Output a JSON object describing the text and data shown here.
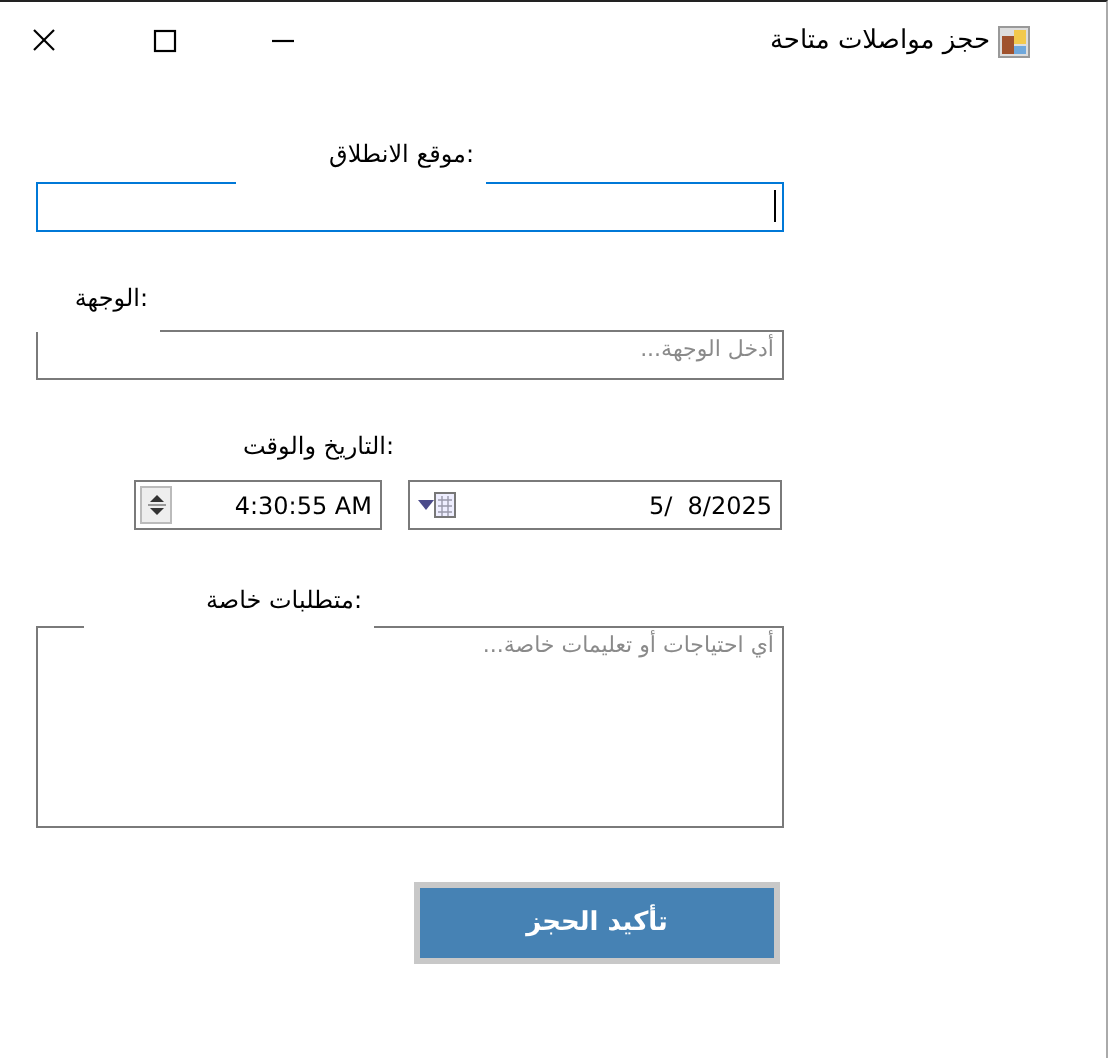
{
  "window": {
    "title": "حجز مواصلات متاحة"
  },
  "fields": [
    {
      "kind": "text",
      "label": "موقع الانطلاق:",
      "focused": true
    },
    {
      "kind": "text",
      "label": "الوجهة:",
      "placeholder": "أدخل الوجهة...",
      "focused": false
    },
    {
      "kind": "datetime",
      "label": "التاريخ والوقت:",
      "time": "4:30:55 AM",
      "date": "5/  8/2025"
    },
    {
      "kind": "textarea",
      "label": "متطلبات خاصة:",
      "placeholder": "أي احتياجات أو تعليمات خاصة...",
      "focused": false
    }
  ],
  "button": {
    "label": "تأكيد الحجز"
  }
}
